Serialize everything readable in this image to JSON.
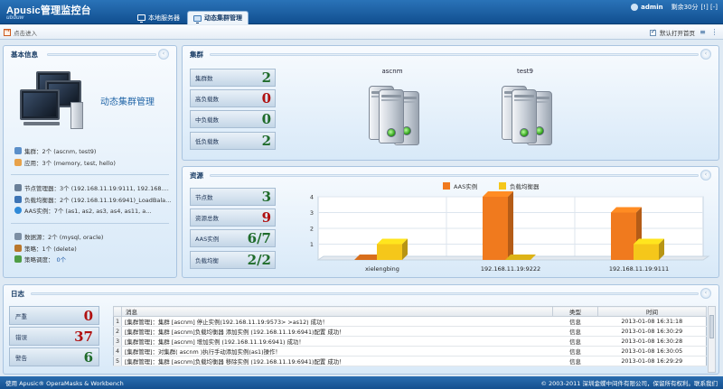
{
  "header": {
    "logo_main": "Apusic管理监控台",
    "logo_sub": "ubuuw",
    "tabs": [
      {
        "label": "本地服务器",
        "active": false
      },
      {
        "label": "动态集群管理",
        "active": true
      }
    ],
    "user": "admin",
    "session_left": "剩余30分",
    "links": "[!] [-]"
  },
  "toolbar": {
    "enter_label": "点击进入",
    "default_open_label": "默认打开首页",
    "default_open_checked": true
  },
  "basic_info": {
    "title": "基本信息",
    "product_title": "动态集群管理",
    "rows": [
      {
        "label": "集群：2个 (ascnm, test9)",
        "icon": "cluster-icon"
      },
      {
        "label": "应用：3个 (memory, test, hello)",
        "icon": "app-icon"
      }
    ],
    "rows2": [
      {
        "label": "节点管理器：3个 (192.168.11.19:9111, 192.168....",
        "icon": "node-manager-icon"
      },
      {
        "label": "负载均衡器：2个 (192.168.11.19:6941)_LoadBala...",
        "icon": "load-balancer-icon"
      },
      {
        "label": "AAS实例：7个 (as1, as2, as3, as4, as11, a...",
        "icon": "aas-instance-icon"
      }
    ],
    "rows3": [
      {
        "label": "数据源：2个 (mysql, oracle)",
        "icon": "datasource-icon"
      },
      {
        "label": "策略：1个 (delete)",
        "icon": "policy-icon"
      },
      {
        "label": "策略调度：",
        "link": "0个",
        "icon": "schedule-icon"
      }
    ]
  },
  "cluster": {
    "title": "集群",
    "stats": [
      {
        "label": "集群数",
        "value": "2",
        "color": "#1f6b2a"
      },
      {
        "label": "高负载数",
        "value": "0",
        "color": "#b01010"
      },
      {
        "label": "中负载数",
        "value": "0",
        "color": "#1f6b2a"
      },
      {
        "label": "低负载数",
        "value": "2",
        "color": "#1f6b2a"
      }
    ],
    "servers": [
      {
        "name": "ascnm"
      },
      {
        "name": "test9"
      }
    ]
  },
  "resources": {
    "title": "资源",
    "stats": [
      {
        "label": "节点数",
        "value": "3",
        "color": "#1f6b2a"
      },
      {
        "label": "资源总数",
        "value": "9",
        "color": "#b01010"
      },
      {
        "label": "AAS实例",
        "value": "6/7",
        "color": "#1f6b2a"
      },
      {
        "label": "负载均衡",
        "value": "2/2",
        "color": "#1f6b2a"
      }
    ]
  },
  "chart_data": {
    "type": "bar",
    "categories": [
      "xielengbing",
      "192.168.11.19:9222",
      "192.168.11.19:9111"
    ],
    "series": [
      {
        "name": "AAS实例",
        "values": [
          0,
          4,
          3
        ],
        "color": "#f07a1e"
      },
      {
        "name": "负载均衡器",
        "values": [
          1,
          0,
          1
        ],
        "color": "#f5c71a"
      }
    ],
    "ylim": [
      0,
      4
    ],
    "yticks": [
      "1",
      "2",
      "3",
      "4"
    ],
    "legend": "top",
    "grid": true
  },
  "log": {
    "title": "日志",
    "stats": [
      {
        "label": "严重",
        "value": "0",
        "color": "#b01010"
      },
      {
        "label": "错误",
        "value": "37",
        "color": "#b01010"
      },
      {
        "label": "警告",
        "value": "6",
        "color": "#1f6b2a"
      }
    ],
    "columns": [
      "消息",
      "类型",
      "时间"
    ],
    "rows": [
      {
        "n": "1",
        "msg": "[集群管理]：集群 [ascnm] 停止实例(192.168.11.19:9573> >as12) 成功！",
        "type": "信息",
        "time": "2013-01-08 16:31:18"
      },
      {
        "n": "2",
        "msg": "[集群管理]：集群 [ascnm]负载均衡器 添加实例 (192.168.11.19:6941)配置 成功！",
        "type": "信息",
        "time": "2013-01-08 16:30:29"
      },
      {
        "n": "3",
        "msg": "[集群管理]：集群 [ascnm] 增加实例 (192.168.11.19:6941) 成功！",
        "type": "信息",
        "time": "2013-01-08 16:30:28"
      },
      {
        "n": "4",
        "msg": "[集群管理]：对集群( ascnm )执行手动添加实例(as1)操作！",
        "type": "信息",
        "time": "2013-01-08 16:30:05"
      },
      {
        "n": "5",
        "msg": "[集群管理]：集群 [ascnm]负载均衡器 移除实例 (192.168.11.19:6941)配置 成功！",
        "type": "信息",
        "time": "2013-01-08 16:29:29"
      }
    ]
  },
  "statusbar": {
    "left": "使用 Apusic® OperaMasks & Workbench",
    "right": "© 2003-2011 深圳金蝶中间件有限公司，保留所有权利。联系我们"
  }
}
